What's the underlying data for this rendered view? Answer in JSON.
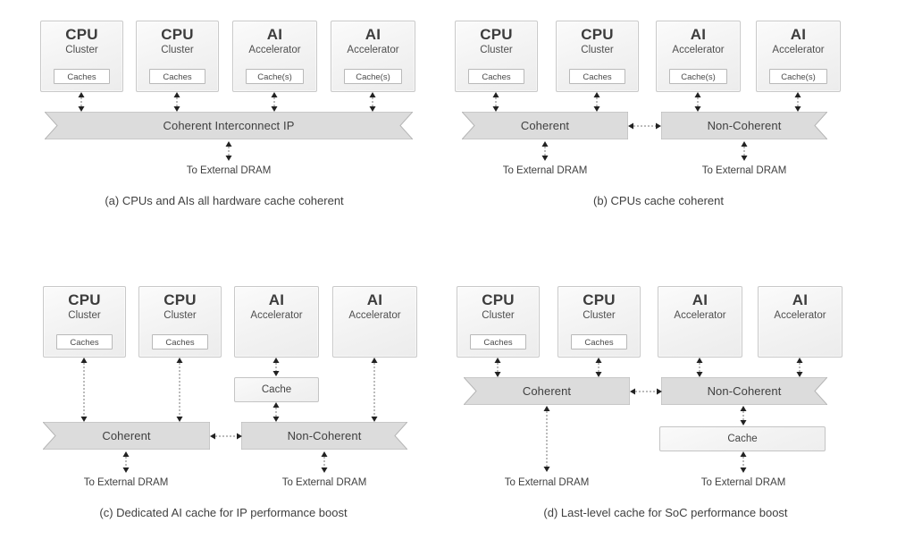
{
  "figure": {
    "background": "#ffffff",
    "accent_bar_fill": "#dcdcdc",
    "box_fill": "#f2f2f2",
    "border_color": "#c4c4c4",
    "text_color": "#3f3f3f"
  },
  "labels": {
    "cpu_title": "CPU",
    "cpu_sub": "Cluster",
    "ai_title": "AI",
    "ai_sub": "Accelerator",
    "caches": "Caches",
    "cache_s": "Cache(s)",
    "cache": "Cache",
    "coherent_interconnect_ip": "Coherent Interconnect IP",
    "coherent": "Coherent",
    "non_coherent": "Non-Coherent",
    "to_external_dram": "To External DRAM"
  },
  "panels": [
    {
      "id": "a",
      "caption": "(a) CPUs and AIs all hardware cache coherent",
      "blocks": [
        {
          "title": "CPU",
          "sub": "Cluster",
          "cache": "Caches"
        },
        {
          "title": "CPU",
          "sub": "Cluster",
          "cache": "Caches"
        },
        {
          "title": "AI",
          "sub": "Accelerator",
          "cache": "Cache(s)"
        },
        {
          "title": "AI",
          "sub": "Accelerator",
          "cache": "Cache(s)"
        }
      ],
      "bars": [
        {
          "label": "Coherent Interconnect IP",
          "notch": "both"
        }
      ],
      "dram": [
        "To External DRAM"
      ]
    },
    {
      "id": "b",
      "caption": "(b) CPUs cache coherent",
      "blocks": [
        {
          "title": "CPU",
          "sub": "Cluster",
          "cache": "Caches"
        },
        {
          "title": "CPU",
          "sub": "Cluster",
          "cache": "Caches"
        },
        {
          "title": "AI",
          "sub": "Accelerator",
          "cache": "Cache(s)"
        },
        {
          "title": "AI",
          "sub": "Accelerator",
          "cache": "Cache(s)"
        }
      ],
      "bars": [
        {
          "label": "Coherent",
          "notch": "left"
        },
        {
          "label": "Non-Coherent",
          "notch": "right"
        }
      ],
      "dram": [
        "To External DRAM",
        "To External DRAM"
      ]
    },
    {
      "id": "c",
      "caption": "(c) Dedicated AI cache for IP performance boost",
      "blocks": [
        {
          "title": "CPU",
          "sub": "Cluster",
          "cache": "Caches"
        },
        {
          "title": "CPU",
          "sub": "Cluster",
          "cache": "Caches"
        },
        {
          "title": "AI",
          "sub": "Accelerator",
          "cache": null
        },
        {
          "title": "AI",
          "sub": "Accelerator",
          "cache": null
        }
      ],
      "mid_cache": "Cache",
      "bars": [
        {
          "label": "Coherent",
          "notch": "left"
        },
        {
          "label": "Non-Coherent",
          "notch": "right"
        }
      ],
      "dram": [
        "To External DRAM",
        "To External DRAM"
      ]
    },
    {
      "id": "d",
      "caption": "(d) Last-level cache for SoC performance boost",
      "blocks": [
        {
          "title": "CPU",
          "sub": "Cluster",
          "cache": "Caches"
        },
        {
          "title": "CPU",
          "sub": "Cluster",
          "cache": "Caches"
        },
        {
          "title": "AI",
          "sub": "Accelerator",
          "cache": null
        },
        {
          "title": "AI",
          "sub": "Accelerator",
          "cache": null
        }
      ],
      "llc_cache": "Cache",
      "bars": [
        {
          "label": "Coherent",
          "notch": "left"
        },
        {
          "label": "Non-Coherent",
          "notch": "right"
        }
      ],
      "dram": [
        "To External DRAM",
        "To External DRAM"
      ]
    }
  ]
}
